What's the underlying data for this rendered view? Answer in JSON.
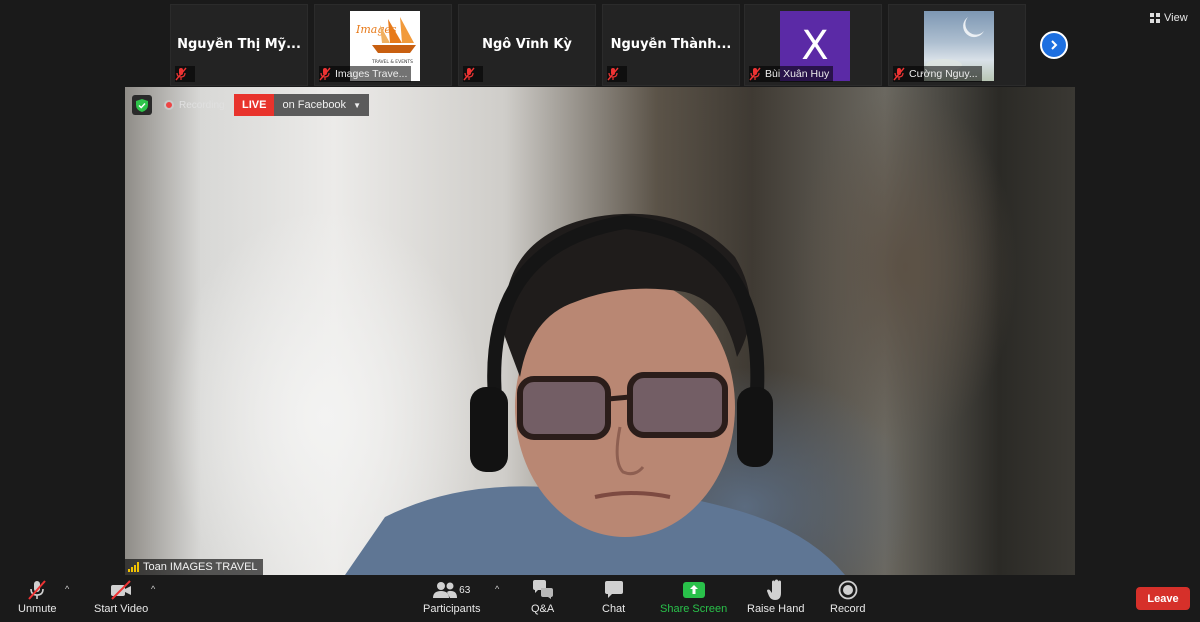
{
  "gallery": {
    "tiles": [
      {
        "kind": "name",
        "display_name": "Nguyễn Thị Mỹ...",
        "footer_label": ""
      },
      {
        "kind": "logo",
        "logo_text": "Images",
        "logo_sub": "TRAVEL & EVENTS",
        "footer_label": "Images Trave..."
      },
      {
        "kind": "name",
        "display_name": "Ngô Vĩnh Kỳ",
        "footer_label": ""
      },
      {
        "kind": "name",
        "display_name": "Nguyễn  Thành...",
        "footer_label": ""
      },
      {
        "kind": "avatar",
        "avatar_letter": "X",
        "footer_label": "Bùi Xuân Huy"
      },
      {
        "kind": "photo",
        "footer_label": "Cường Nguy..."
      }
    ],
    "next_icon": "chevron-right-icon",
    "view_label": "View"
  },
  "video": {
    "recording_label": "Recording",
    "live_label": "LIVE",
    "live_target": "on Facebook",
    "speaker_name": "Toan IMAGES TRAVEL"
  },
  "toolbar": {
    "unmute": "Unmute",
    "start_video": "Start Video",
    "participants": "Participants",
    "participants_count": "63",
    "qa": "Q&A",
    "chat": "Chat",
    "share_screen": "Share Screen",
    "raise_hand": "Raise Hand",
    "record": "Record",
    "leave": "Leave"
  },
  "colors": {
    "leave": "#d6302a",
    "live": "#e8332c",
    "share_screen": "#29c14a",
    "next_button": "#1d6fe0",
    "avatar_bg": "#5b2aa6"
  }
}
